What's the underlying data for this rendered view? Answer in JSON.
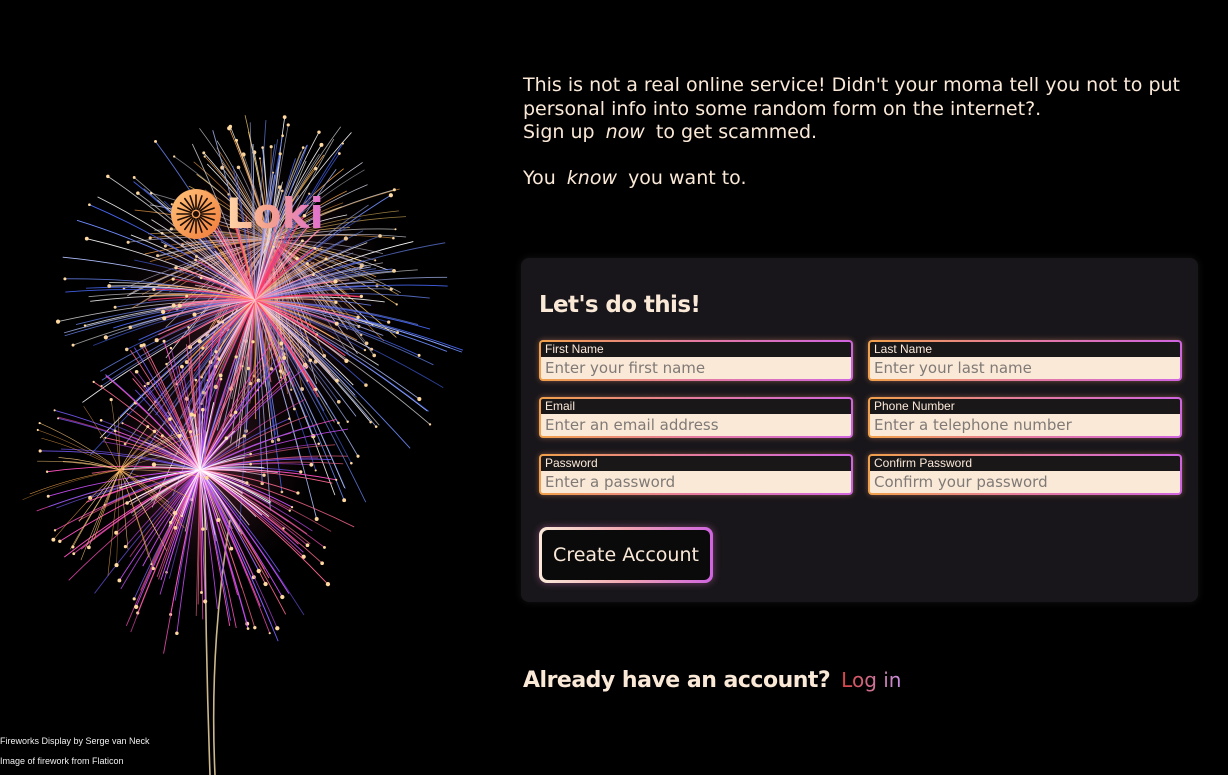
{
  "brand": {
    "name": "Loki",
    "gradient": [
      "#ffd7a8",
      "#f5a58c",
      "#e06fd0"
    ]
  },
  "intro": {
    "line1": "This is not a real online service! Didn't your moma tell you not to put personal info into some random form on the internet?.",
    "line2_before": "Sign up",
    "line2_emph": "now",
    "line2_after": "to get scammed.",
    "line3_before": "You",
    "line3_emph": "know",
    "line3_after": "you want to."
  },
  "form": {
    "title": "Let's do this!",
    "fields": {
      "first_name": {
        "label": "First Name",
        "placeholder": "Enter your first name",
        "value": ""
      },
      "last_name": {
        "label": "Last Name",
        "placeholder": "Enter your last name",
        "value": ""
      },
      "email": {
        "label": "Email",
        "placeholder": "Enter an email address",
        "value": ""
      },
      "phone": {
        "label": "Phone Number",
        "placeholder": "Enter a telephone number",
        "value": ""
      },
      "password": {
        "label": "Password",
        "placeholder": "Enter a password",
        "value": ""
      },
      "confirm_password": {
        "label": "Confirm Password",
        "placeholder": "Confirm your password",
        "value": ""
      }
    },
    "submit_label": "Create Account"
  },
  "login": {
    "question": "Already have an account?",
    "link_label": "Log in"
  },
  "credits": {
    "photo": "Fireworks Display by Serge van Neck",
    "icon": "Image of firework from Flaticon"
  },
  "colors": {
    "background": "#000000",
    "card": "#18161a",
    "text": "#fbe9d8",
    "accent_orange": "#f0a04a",
    "accent_pink": "#e57aa0",
    "accent_purple": "#d064e0"
  }
}
